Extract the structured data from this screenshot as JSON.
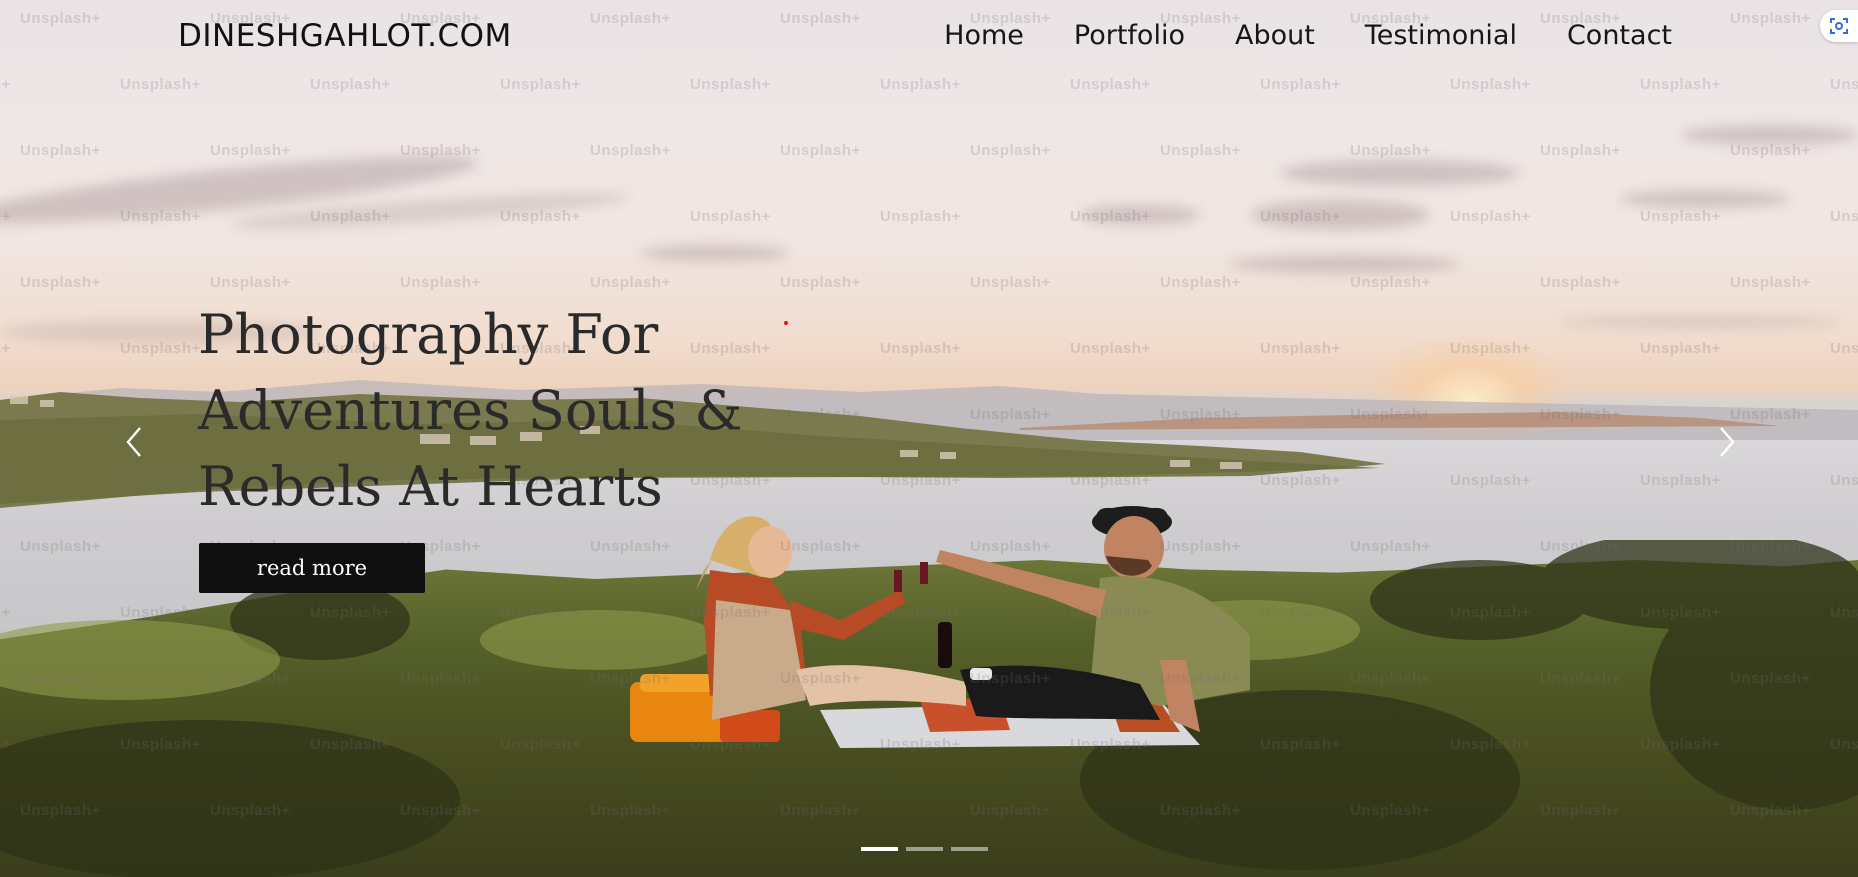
{
  "header": {
    "brand": "DINESHGAHLOT.COM",
    "nav": [
      "Home",
      "Portfolio",
      "About",
      "Testimonial",
      "Contact"
    ]
  },
  "hero": {
    "headline_lines": [
      "Photography For",
      "Adventures Souls &",
      "Rebels At Hearts"
    ],
    "cta_label": "read more",
    "prev_icon": "chevron-left-icon",
    "next_icon": "chevron-right-icon",
    "slides_total": 3,
    "slide_active": 1
  },
  "watermark": "Unsplash+",
  "colors": {
    "nav_text": "#161616",
    "cta_bg": "#0f0f0f",
    "cta_text": "#ffffff",
    "indicator_active": "#ffffff"
  },
  "corner_widget": {
    "icon": "screen-capture-icon"
  }
}
